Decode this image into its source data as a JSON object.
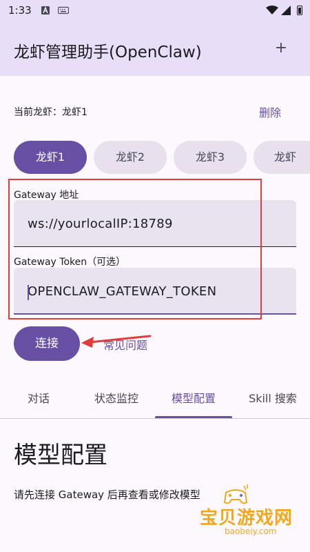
{
  "status_bar": {
    "time": "1:33",
    "icons": [
      "notification-a-icon",
      "keyboard-icon",
      "wifi-icon",
      "signal-icon",
      "battery-icon"
    ]
  },
  "app_bar": {
    "title": "龙虾管理助手(OpenClaw)",
    "add_label": "+"
  },
  "current": {
    "label": "当前龙虾：龙虾1",
    "delete_label": "删除"
  },
  "chips": [
    {
      "label": "龙虾1",
      "selected": true
    },
    {
      "label": "龙虾2",
      "selected": false
    },
    {
      "label": "龙虾3",
      "selected": false
    },
    {
      "label": "龙虾",
      "selected": false
    }
  ],
  "gateway": {
    "address_label": "Gateway 地址",
    "address_value": "ws://yourlocalIP:18789",
    "token_label": "Gateway Token（可选）",
    "token_value": "OPENCLAW_GATEWAY_TOKEN"
  },
  "actions": {
    "connect_label": "连接",
    "help_label": "常见问题"
  },
  "tabs": [
    {
      "label": "对话",
      "active": false
    },
    {
      "label": "状态监控",
      "active": false
    },
    {
      "label": "模型配置",
      "active": true
    },
    {
      "label": "Skill 搜索",
      "active": false
    }
  ],
  "section": {
    "title": "模型配置",
    "hint": "请先连接 Gateway 后再查看或修改模型"
  },
  "watermark": {
    "title": "宝贝游戏网",
    "url": "baobeiy.com"
  },
  "colors": {
    "primary": "#6750a4",
    "app_bar_bg": "#e8def8",
    "chip_bg": "#e8e0ec",
    "highlight_box": "#e23b3b",
    "watermark": "#f2a61d"
  }
}
